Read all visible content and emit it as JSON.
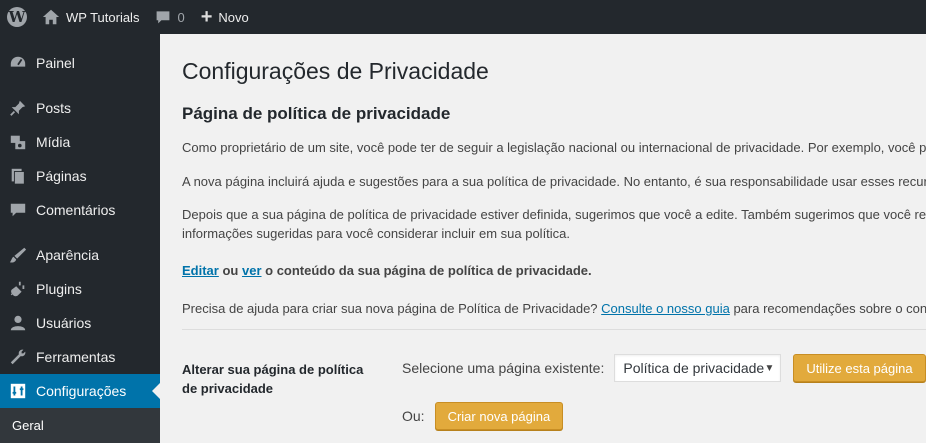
{
  "adminbar": {
    "site_name": "WP Tutorials",
    "comments_count": "0",
    "new_label": "Novo"
  },
  "sidebar": {
    "items": [
      {
        "label": "Painel",
        "icon": "dashboard-icon"
      },
      {
        "label": "Posts",
        "icon": "pin-icon"
      },
      {
        "label": "Mídia",
        "icon": "media-icon"
      },
      {
        "label": "Páginas",
        "icon": "pages-icon"
      },
      {
        "label": "Comentários",
        "icon": "comment-icon"
      },
      {
        "label": "Aparência",
        "icon": "brush-icon"
      },
      {
        "label": "Plugins",
        "icon": "plugin-icon"
      },
      {
        "label": "Usuários",
        "icon": "user-icon"
      },
      {
        "label": "Ferramentas",
        "icon": "wrench-icon"
      },
      {
        "label": "Configurações",
        "icon": "settings-icon"
      }
    ],
    "submenu_first": "Geral"
  },
  "page": {
    "title": "Configurações de Privacidade",
    "section_title": "Página de política de privacidade",
    "p1": "Como proprietário de um site, você pode ter de seguir a legislação nacional ou internacional de privacidade. Por exemplo, você po",
    "p2": "A nova página incluirá ajuda e sugestões para a sua política de privacidade. No entanto, é sua responsabilidade usar esses recurso",
    "p3_line1": "Depois que a sua página de política de privacidade estiver definida, sugerimos que você a edite. Também sugerimos que você revi",
    "p3_line2": "informações sugeridas para você considerar incluir em sua política.",
    "edit_link": "Editar",
    "or_text": "ou",
    "view_link": "ver",
    "edit_rest": "o conteúdo da sua página de política de privacidade.",
    "help_before": "Precisa de ajuda para criar sua nova página de Política de Privacidade?",
    "help_link": "Consulte o nosso guia",
    "help_after": "para recomendações sobre o conteú",
    "form_label": "Alterar sua página de política de privacidade",
    "select_label": "Selecione uma página existente:",
    "select_value": "Política de privacidade",
    "use_button": "Utilize esta página",
    "or_label": "Ou:",
    "create_button": "Criar nova página"
  },
  "colors": {
    "adminbar_bg": "#23282d",
    "current_menu": "#0073aa",
    "button": "#e2aa3c",
    "link": "#0073aa"
  }
}
